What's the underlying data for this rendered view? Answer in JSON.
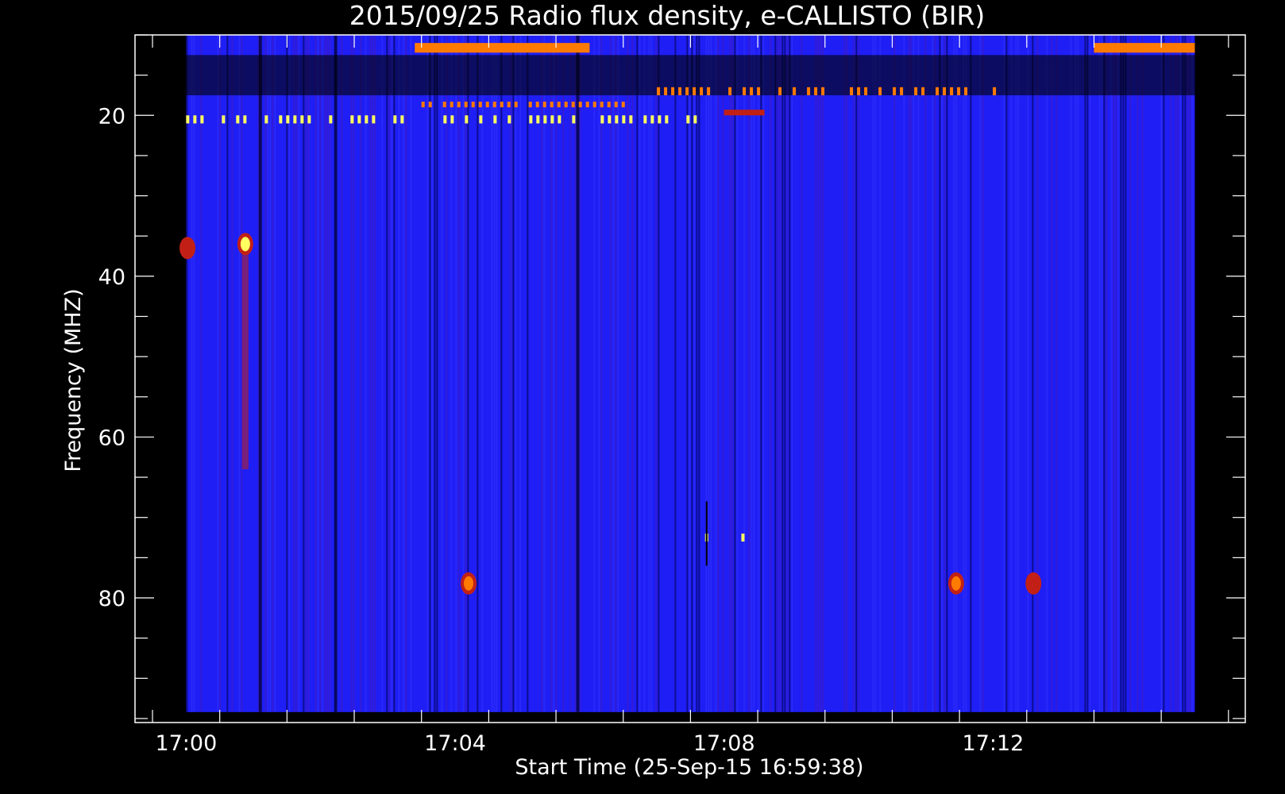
{
  "chart_data": {
    "type": "heatmap",
    "title": "2015/09/25  Radio flux density, e-CALLISTO (BIR)",
    "xlabel": "Start Time (25-Sep-15 16:59:38)",
    "ylabel": "Frequency (MHZ)",
    "x_axis": {
      "unit": "minutes after 17:00",
      "ticks": [
        0,
        4,
        8,
        12
      ],
      "tick_labels": [
        "17:00",
        "17:04",
        "17:08",
        "17:12"
      ],
      "range": [
        -0.76,
        15.75
      ],
      "data_start": 0,
      "data_end": 15
    },
    "y_axis": {
      "unit": "MHz",
      "inverted": true,
      "ticks": [
        20,
        40,
        60,
        80
      ],
      "tick_labels": [
        "20",
        "40",
        "60",
        "80"
      ],
      "range": [
        10,
        95.5
      ],
      "data_start": 10,
      "data_end": 94.2
    },
    "colormap": [
      "#000000",
      "#1616ff",
      "#c22016",
      "#ff7a00",
      "#ffff60"
    ],
    "background_level": "blue",
    "features": [
      {
        "name": "band",
        "t0": 3.4,
        "t1": 6.0,
        "f0": 11.0,
        "f1": 12.2,
        "level": "orange"
      },
      {
        "name": "band",
        "t0": 13.5,
        "t1": 15.0,
        "f0": 11.0,
        "f1": 12.2,
        "level": "orange"
      },
      {
        "name": "band",
        "t0": 0.0,
        "t1": 15.0,
        "f0": 12.5,
        "f1": 17.5,
        "level": "dark"
      },
      {
        "name": "band",
        "t0": 0.0,
        "t1": 7.6,
        "f0": 20.0,
        "f1": 21.0,
        "level": "yellow-dashed"
      },
      {
        "name": "band",
        "t0": 3.5,
        "t1": 6.6,
        "f0": 18.3,
        "f1": 19.0,
        "level": "orange-dashed"
      },
      {
        "name": "band",
        "t0": 7.0,
        "t1": 12.0,
        "f0": 16.5,
        "f1": 17.5,
        "level": "orange-dashed"
      },
      {
        "name": "band",
        "t0": 8.0,
        "t1": 8.6,
        "f0": 19.3,
        "f1": 20.0,
        "level": "red"
      },
      {
        "name": "burst",
        "t": 0.88,
        "f": 36.0,
        "level": "yellow"
      },
      {
        "name": "burst",
        "t": 0.02,
        "f": 36.5,
        "level": "red"
      },
      {
        "name": "burst",
        "t": 4.2,
        "f": 78.2,
        "level": "orange"
      },
      {
        "name": "burst",
        "t": 11.45,
        "f": 78.2,
        "level": "orange"
      },
      {
        "name": "burst",
        "t": 12.6,
        "f": 78.2,
        "level": "red"
      },
      {
        "name": "spike",
        "t": 7.74,
        "f": 72.5,
        "level": "yellow"
      },
      {
        "name": "spike",
        "t": 8.28,
        "f": 72.5,
        "level": "yellow"
      }
    ]
  }
}
